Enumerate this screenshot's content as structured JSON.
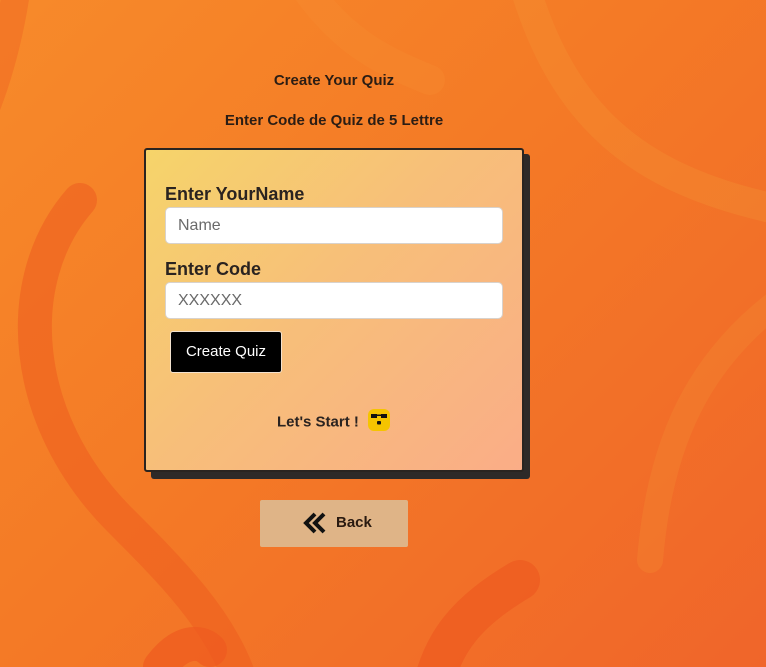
{
  "header": {
    "title": "Create Your Quiz",
    "subtitle": "Enter Code de Quiz de 5 Lettre"
  },
  "form": {
    "name_label": "Enter YourName",
    "name_placeholder": "Name",
    "name_value": "",
    "code_label": "Enter Code",
    "code_placeholder": "XXXXXX",
    "code_value": "",
    "create_button_label": "Create Quiz",
    "lets_start_text": "Let's Start !",
    "emoji_icon": "cool-sunglasses-emoji-icon"
  },
  "footer": {
    "back_label": "Back",
    "back_icon": "double-chevron-left-icon"
  },
  "colors": {
    "background": "#f47a26",
    "card_gradient_start": "#f6d46a",
    "card_gradient_end": "#faad87",
    "create_button": "#000000",
    "back_button": "#dfb487"
  }
}
